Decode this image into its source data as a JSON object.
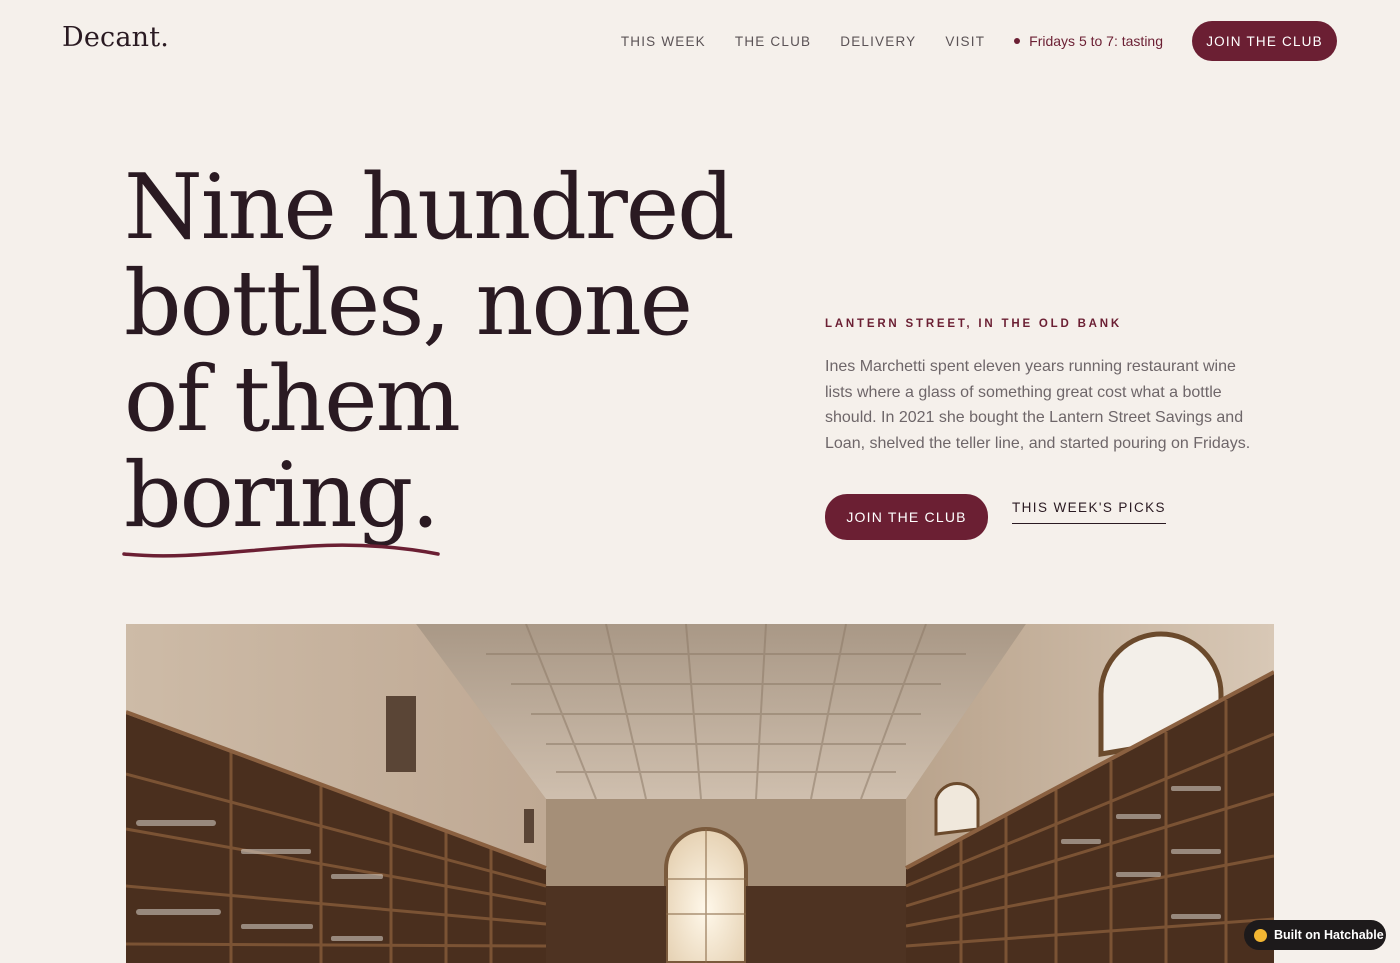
{
  "brand": {
    "logo": "Decant."
  },
  "nav": {
    "links": [
      "THIS WEEK",
      "THE CLUB",
      "DELIVERY",
      "VISIT"
    ],
    "status": "Fridays 5 to 7: tasting",
    "cta": "JOIN THE CLUB"
  },
  "hero": {
    "headline_lines": [
      "Nine hundred",
      "bottles, none",
      "of them",
      "boring."
    ],
    "eyebrow": "LANTERN STREET, IN THE OLD BANK",
    "intro": "Ines Marchetti spent eleven years running restaurant wine lists where a glass of something great cost what a bottle should. In 2021 she bought the Lantern Street Savings and Loan, shelved the teller line, and started pouring on Fridays.",
    "primary_cta": "JOIN THE CLUB",
    "secondary_cta": "THIS WEEK'S PICKS"
  },
  "image": {
    "subject": "wine-shop-interior-photo"
  },
  "badge": {
    "label": "Built on Hatchable",
    "icon": "hatchable-icon"
  },
  "colors": {
    "accent": "#6b1f33",
    "background": "#f5f0eb",
    "ink": "#2a1a22"
  }
}
